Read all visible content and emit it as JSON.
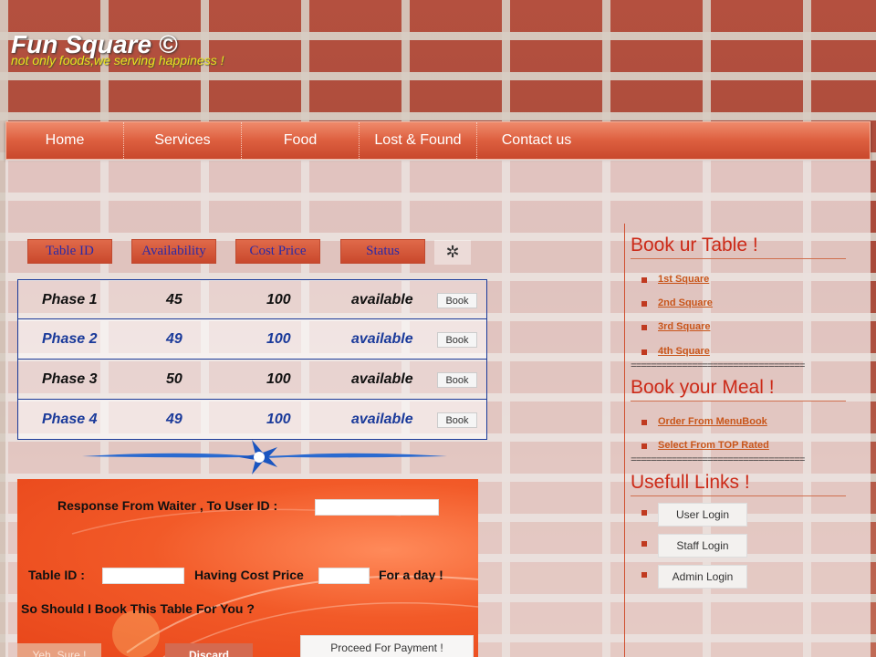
{
  "brand": {
    "title": "Fun Square ©",
    "tagline": "not only foods,we serving happiness !"
  },
  "nav": [
    "Home",
    "Services",
    "Food",
    "Lost & Found",
    "Contact us"
  ],
  "table": {
    "headers": [
      "Table ID",
      "Availability",
      "Cost Price",
      "Status"
    ],
    "rows": [
      {
        "id": "Phase 1",
        "availability": "45",
        "cost": "100",
        "status": "available",
        "action": "Book"
      },
      {
        "id": "Phase 2",
        "availability": "49",
        "cost": "100",
        "status": "available",
        "action": "Book"
      },
      {
        "id": "Phase 3",
        "availability": "50",
        "cost": "100",
        "status": "available",
        "action": "Book"
      },
      {
        "id": "Phase 4",
        "availability": "49",
        "cost": "100",
        "status": "available",
        "action": "Book"
      }
    ]
  },
  "waiter": {
    "response_label": "Response From Waiter , To User ID  :",
    "table_id_label": "Table ID   :",
    "cost_label": "Having Cost Price",
    "day_label": "For a day !",
    "question": "So Should I Book This Table For You  ?",
    "yes_label": "Yeh, Sure !",
    "discard_label": "Discard",
    "proceed_label": "Proceed For Payment !"
  },
  "sidebar": {
    "book_table_heading": "Book ur Table !",
    "squares": [
      "1st Square",
      "2nd Square",
      "3rd Square",
      "4th Square"
    ],
    "separator": "==================================",
    "book_meal_heading": "Book your Meal !",
    "meal_links": [
      "Order From  MenuBook",
      "Select  From TOP  Rated"
    ],
    "useful_heading": "Usefull Links !",
    "logins": [
      "User Login",
      "Staff Login",
      "Admin Login"
    ]
  },
  "colors": {
    "nav": "#dd5f3f",
    "heading": "#cc2a18",
    "link": "#c8551a",
    "table_border": "#1a3a9a",
    "panel": "#f25a28"
  }
}
